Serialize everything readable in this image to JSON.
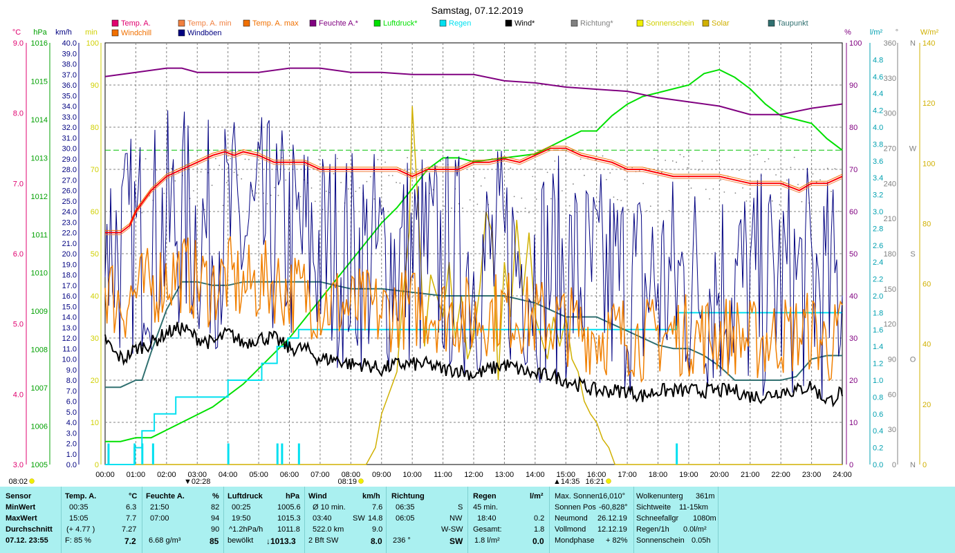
{
  "title": "Samstag, 07.12.2019",
  "legend": [
    {
      "label": "Temp. A.",
      "color": "#e0006f"
    },
    {
      "label": "Temp. A. min",
      "color": "#f07f3f"
    },
    {
      "label": "Temp. A. max",
      "color": "#f07000"
    },
    {
      "label": "Feuchte A.*",
      "color": "#800080"
    },
    {
      "label": "Luftdruck*",
      "color": "#00e000"
    },
    {
      "label": "Regen",
      "color": "#00e0f0"
    },
    {
      "label": "Wind*",
      "color": "#000000"
    },
    {
      "label": "Richtung*",
      "color": "#808080"
    },
    {
      "label": "Sonnenschein",
      "color": "#f0f000"
    },
    {
      "label": "Solar",
      "color": "#d0b000"
    },
    {
      "label": "Taupunkt",
      "color": "#307070"
    },
    {
      "label": "Windchill",
      "color": "#f07000"
    },
    {
      "label": "Windböen",
      "color": "#000080"
    }
  ],
  "axis_units": {
    "temp": "°C",
    "press": "hPa",
    "wind": "km/h",
    "min": "min",
    "hum": "%",
    "rain": "l/m²",
    "dir": "°",
    "solar": "W/m²"
  },
  "chart_data": {
    "type": "line",
    "x_ticks": [
      "00:00",
      "01:00",
      "02:00",
      "03:00",
      "04:00",
      "05:00",
      "06:00",
      "07:00",
      "08:00",
      "09:00",
      "10:00",
      "11:00",
      "12:00",
      "13:00",
      "14:00",
      "15:00",
      "16:00",
      "17:00",
      "18:00",
      "19:00",
      "20:00",
      "21:00",
      "22:00",
      "23:00",
      "24:00"
    ],
    "temp_ticks": [
      "3.0",
      "4.0",
      "5.0",
      "6.0",
      "7.0",
      "8.0",
      "9.0"
    ],
    "press_ticks": [
      "1005",
      "1006",
      "1007",
      "1008",
      "1009",
      "1010",
      "1011",
      "1012",
      "1013",
      "1014",
      "1015",
      "1016"
    ],
    "wind_ticks": [
      "0.0",
      "1.0",
      "2.0",
      "3.0",
      "4.0",
      "5.0",
      "6.0",
      "7.0",
      "8.0",
      "9.0",
      "10.0",
      "11.0",
      "12.0",
      "13.0",
      "14.0",
      "15.0",
      "16.0",
      "17.0",
      "18.0",
      "19.0",
      "20.0",
      "21.0",
      "22.0",
      "23.0",
      "24.0",
      "25.0",
      "26.0",
      "27.0",
      "28.0",
      "29.0",
      "30.0",
      "31.0",
      "32.0",
      "33.0",
      "34.0",
      "35.0",
      "36.0",
      "37.0",
      "38.0",
      "39.0",
      "40.0"
    ],
    "min_ticks": [
      "0",
      "10",
      "20",
      "30",
      "40",
      "50",
      "60",
      "70",
      "80",
      "90",
      "100"
    ],
    "hum_ticks": [
      "0",
      "10",
      "20",
      "30",
      "40",
      "50",
      "60",
      "70",
      "80",
      "90",
      "100"
    ],
    "rain_ticks": [
      "0.0",
      "0.2",
      "0.4",
      "0.6",
      "0.8",
      "1.0",
      "1.2",
      "1.4",
      "1.6",
      "1.8",
      "2.0",
      "2.2",
      "2.4",
      "2.6",
      "2.8",
      "3.0",
      "3.2",
      "3.4",
      "3.6",
      "3.8",
      "4.0",
      "4.2",
      "4.4",
      "4.6",
      "4.8"
    ],
    "dir_ticks": [
      {
        "v": "0",
        "l": "N"
      },
      {
        "v": "30",
        "l": ""
      },
      {
        "v": "60",
        "l": ""
      },
      {
        "v": "90",
        "l": "O"
      },
      {
        "v": "120",
        "l": ""
      },
      {
        "v": "150",
        "l": ""
      },
      {
        "v": "180",
        "l": "S"
      },
      {
        "v": "210",
        "l": ""
      },
      {
        "v": "240",
        "l": ""
      },
      {
        "v": "270",
        "l": "W"
      },
      {
        "v": "300",
        "l": ""
      },
      {
        "v": "330",
        "l": ""
      },
      {
        "v": "360",
        "l": "N"
      }
    ],
    "solar_ticks": [
      "0",
      "20",
      "40",
      "60",
      "80",
      "100",
      "120",
      "140"
    ],
    "temp_range": [
      3,
      9
    ],
    "series": {
      "temp": {
        "x": [
          0,
          0.5,
          0.8,
          1.0,
          1.5,
          2.0,
          2.5,
          3.0,
          3.5,
          3.9,
          4.2,
          4.5,
          5.0,
          5.5,
          6.0,
          6.5,
          7.0,
          8.0,
          9.0,
          9.5,
          10.0,
          10.5,
          11.0,
          11.5,
          12.0,
          12.5,
          13.0,
          13.5,
          14.0,
          14.5,
          15.0,
          15.5,
          16.0,
          16.5,
          17.0,
          17.5,
          18.0,
          18.5,
          19.0,
          19.5,
          20.0,
          20.5,
          21.0,
          21.5,
          22.0,
          22.3,
          22.6,
          23.0,
          23.5,
          24.0
        ],
        "y": [
          6.3,
          6.3,
          6.4,
          6.6,
          6.9,
          7.1,
          7.2,
          7.3,
          7.4,
          7.45,
          7.4,
          7.45,
          7.4,
          7.3,
          7.3,
          7.3,
          7.2,
          7.2,
          7.2,
          7.2,
          7.1,
          7.2,
          7.2,
          7.2,
          7.3,
          7.3,
          7.35,
          7.3,
          7.4,
          7.5,
          7.5,
          7.4,
          7.35,
          7.3,
          7.2,
          7.2,
          7.15,
          7.1,
          7.1,
          7.1,
          7.1,
          7.05,
          7.0,
          7.0,
          7.0,
          6.95,
          6.9,
          7.0,
          7.0,
          7.1
        ]
      },
      "dewpoint_t": {
        "x": [
          0,
          0.5,
          1.0,
          1.2,
          1.5,
          2.0,
          2.5,
          3.0,
          3.5,
          4.0,
          4.5,
          5.0,
          5.5,
          6.0,
          6.5,
          7.0,
          7.5,
          8.0,
          9.0,
          10.0,
          11.0,
          12.0,
          13.0,
          14.0,
          15.0,
          16.0,
          17.0,
          17.5,
          18.0,
          18.5,
          19.0,
          19.5,
          20.0,
          20.5,
          21.0,
          21.5,
          22.0,
          22.5,
          23.0,
          23.5,
          24.0
        ],
        "y": [
          4.1,
          4.1,
          4.2,
          4.2,
          4.6,
          5.2,
          5.6,
          5.6,
          5.55,
          5.55,
          5.6,
          5.6,
          5.6,
          5.6,
          5.6,
          5.6,
          5.55,
          5.5,
          5.5,
          5.45,
          5.4,
          5.4,
          5.4,
          5.3,
          5.1,
          5.1,
          4.9,
          4.8,
          4.7,
          4.65,
          4.65,
          4.55,
          4.4,
          4.2,
          4.2,
          4.2,
          4.2,
          4.25,
          4.5,
          4.55,
          4.55
        ]
      },
      "humidity": {
        "x": [
          0,
          1,
          2,
          2.5,
          3,
          4,
          5,
          6,
          7,
          8,
          9,
          10,
          11,
          12,
          13,
          14,
          15,
          16,
          17,
          18,
          19,
          20,
          20.5,
          21,
          22,
          23,
          24
        ],
        "y": [
          92,
          93,
          94,
          94,
          93,
          93,
          93,
          94,
          94,
          93,
          93,
          92.5,
          92.5,
          92.5,
          91,
          90.5,
          89.5,
          89,
          88.5,
          87,
          86,
          85,
          84,
          83,
          83,
          84.5,
          85.5
        ]
      },
      "pressure": {
        "x": [
          0,
          0.5,
          1.0,
          1.5,
          2.0,
          2.5,
          3.0,
          3.5,
          4.0,
          4.5,
          5.0,
          5.5,
          6.0,
          6.5,
          7.0,
          7.5,
          8.0,
          8.5,
          9.0,
          9.5,
          10.0,
          10.5,
          11.0,
          11.5,
          12.0,
          13.0,
          14.0,
          15.0,
          15.5,
          16.0,
          16.5,
          17.0,
          17.5,
          18.0,
          18.5,
          19.0,
          19.5,
          20.0,
          20.5,
          21.0,
          21.5,
          22.0,
          22.5,
          23.0,
          23.5,
          24.0
        ],
        "y": [
          1005.6,
          1005.6,
          1005.7,
          1005.7,
          1005.9,
          1006.1,
          1006.3,
          1006.5,
          1006.8,
          1007.1,
          1007.5,
          1007.9,
          1008.3,
          1008.8,
          1009.3,
          1009.8,
          1010.3,
          1010.8,
          1011.3,
          1011.7,
          1012.2,
          1012.7,
          1013.0,
          1013.0,
          1012.9,
          1013.0,
          1013.1,
          1013.5,
          1013.7,
          1013.7,
          1014.1,
          1014.4,
          1014.6,
          1014.7,
          1014.8,
          1014.9,
          1015.2,
          1015.3,
          1015.1,
          1014.8,
          1014.4,
          1014.1,
          1014.0,
          1013.9,
          1013.5,
          1013.2
        ]
      },
      "rain_total": {
        "x": [
          0,
          0.95,
          0.95,
          1.2,
          1.2,
          1.6,
          1.6,
          2.3,
          2.3,
          4.0,
          4.0,
          5.1,
          5.1,
          5.6,
          5.6,
          5.95,
          5.95,
          6.3,
          6.3,
          18.6,
          18.6,
          24
        ],
        "y": [
          0,
          0,
          0.2,
          0.2,
          0.4,
          0.4,
          0.6,
          0.6,
          0.8,
          0.8,
          1.0,
          1.0,
          1.2,
          1.2,
          1.4,
          1.4,
          1.5,
          1.5,
          1.6,
          1.6,
          1.8,
          1.8
        ]
      },
      "rain_bars": [
        0.1,
        0.95,
        1.2,
        1.55,
        4.0,
        5.6,
        5.75,
        6.3,
        18.6
      ],
      "wind_avg": {
        "x": [
          0,
          0.3,
          0.6,
          1.0,
          1.5,
          2.0,
          2.5,
          3.0,
          3.5,
          4.0,
          4.5,
          5.0,
          5.5,
          6.0,
          6.5,
          7.0,
          7.5,
          8.0,
          8.5,
          9.0,
          9.5,
          10.0,
          10.5,
          11.0,
          11.5,
          12.0,
          12.5,
          13.0,
          13.5,
          14.0,
          14.5,
          15.0,
          15.5,
          16.0,
          16.5,
          17.0,
          17.5,
          18.0,
          18.5,
          19.0,
          19.5,
          20.0,
          20.5,
          21.0,
          21.5,
          22.0,
          22.5,
          23.0,
          23.3,
          23.6,
          24.0
        ],
        "y": [
          12.0,
          10.5,
          10.0,
          11.0,
          11.5,
          12.5,
          13.0,
          12.0,
          11.5,
          12.5,
          11.5,
          12.0,
          12.0,
          11.0,
          11.0,
          10.0,
          10.0,
          9.5,
          9.5,
          9.0,
          9.5,
          9.5,
          9.5,
          9.0,
          9.0,
          8.5,
          9.0,
          9.5,
          9.0,
          8.5,
          8.5,
          8.0,
          7.5,
          7.0,
          7.0,
          7.0,
          6.5,
          7.0,
          7.0,
          7.0,
          7.0,
          7.0,
          7.0,
          6.5,
          6.5,
          7.0,
          7.0,
          7.5,
          6.5,
          6.0,
          7.0
        ]
      },
      "solar": {
        "x": [
          0,
          8.5,
          8.8,
          9.0,
          9.3,
          9.5,
          9.7,
          9.9,
          10.0,
          10.2,
          10.4,
          10.6,
          10.8,
          11.0,
          11.2,
          11.4,
          11.6,
          11.8,
          12.0,
          12.2,
          12.4,
          12.6,
          12.8,
          13.0,
          13.2,
          13.4,
          13.6,
          13.8,
          14.0,
          14.2,
          14.4,
          14.6,
          14.8,
          15.0,
          15.2,
          15.4,
          15.6,
          15.8,
          16.0,
          16.2,
          16.4,
          16.6,
          24
        ],
        "y": [
          0,
          0,
          4,
          12,
          18,
          22,
          40,
          55,
          85,
          60,
          28,
          45,
          40,
          35,
          48,
          30,
          40,
          25,
          30,
          42,
          60,
          55,
          20,
          48,
          35,
          58,
          40,
          55,
          35,
          30,
          25,
          35,
          28,
          35,
          25,
          22,
          15,
          12,
          10,
          6,
          4,
          0,
          0
        ]
      }
    }
  },
  "sun": {
    "sunrise_left": "08:02",
    "sunrise": "08:19",
    "sunset": "16:21",
    "tmin_marker": "02:28",
    "noon_marker": "14:35"
  },
  "stats": {
    "sensor": {
      "h": "Sensor",
      "r1": "MinWert",
      "r2": "MaxWert",
      "r3": "Durchschnitt",
      "r4": "07.12. 23:55"
    },
    "temp": {
      "h": "Temp. A.",
      "u": "°C",
      "r1a": "00:35",
      "r1b": "6.3",
      "r2a": "15:05",
      "r2b": "7.7",
      "r3a": "(+ 4.77 )",
      "r3b": "7.27",
      "r4a": "F: 85 %",
      "r4b": "7.2"
    },
    "hum": {
      "h": "Feuchte A.",
      "u": "%",
      "r1a": "21:50",
      "r1b": "82",
      "r2a": "07:00",
      "r2b": "94",
      "r3a": "",
      "r3b": "90",
      "r4a": "6.68 g/m³",
      "r4b": "85"
    },
    "press": {
      "h": "Luftdruck",
      "u": "hPa",
      "r1a": "00:25",
      "r1b": "1005.6",
      "r2a": "19:50",
      "r2b": "1015.3",
      "r3a": "^1.2hPa/h",
      "r3b": "1011.8",
      "r4a": "bewölkt",
      "r4b": "↓1013.3"
    },
    "wind": {
      "h": "Wind",
      "u": "km/h",
      "r1a": "Ø 10 min.",
      "r1b": "7.6",
      "r2a": "03:40",
      "r2m": "SW",
      "r2b": "14.8",
      "r3a": "522.0 km",
      "r3b": "9.0",
      "r4a": "2 Bft SW",
      "r4b": "8.0"
    },
    "dir": {
      "h": "Richtung",
      "r1a": "06:35",
      "r1b": "S",
      "r2a": "06:05",
      "r2b": "NW",
      "r3b": "W-SW",
      "r4a": "236 °",
      "r4b": "SW"
    },
    "rain": {
      "h": "Regen",
      "u": "l/m²",
      "r1a": "45 min.",
      "r2a": "18:40",
      "r2b": "0.2",
      "r3a": "Gesamt:",
      "r3b": "1.8",
      "r4a": "1.8 l/m²",
      "r4b": "0.0"
    },
    "astro": {
      "r1a": "Max. Sonnen",
      "r1b": "16,010°",
      "r2a": "Sonnen Pos",
      "r2b": "-60,828°",
      "r3a": "Neumond",
      "r3b": "26.12.19",
      "r4a": "Vollmond",
      "r4b": "12.12.19",
      "r5a": "Mondphase",
      "r5b": "+ 82%"
    },
    "misc": {
      "r1a": "Wolkenunterg",
      "r1b": "361m",
      "r2a": "Sichtweite",
      "r2b": "11-15km",
      "r3a": "Schneefallgr",
      "r3b": "1080m",
      "r4a": "Regen/1h",
      "r4b": "0.0l/m²",
      "r5a": "Sonnenschein",
      "r5b": "0.05h"
    }
  }
}
